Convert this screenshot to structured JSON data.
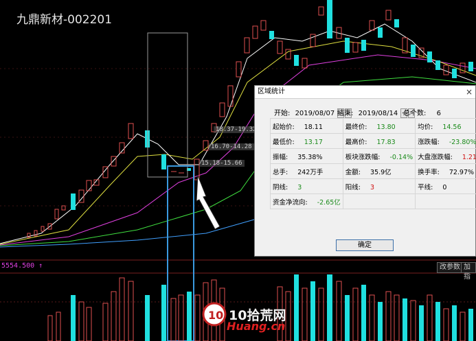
{
  "stock_title": "九鼎新材-002201",
  "volume_label": "5554.500 ↑",
  "buttons": {
    "vol_params": "改参数",
    "add": "加指"
  },
  "annotations": [
    "18.37-19.32",
    "16.70-14.28",
    "15.18-15.66"
  ],
  "watermark": {
    "main": "10拾荒网",
    "sub": "Huang.cn"
  },
  "dialog": {
    "title": "区域统计",
    "close": "×",
    "start_label": "开始:",
    "start_value": "2019/08/07",
    "end_label": "结束:",
    "end_value": "2019/08/14",
    "count_label": "总个数:",
    "count_value": "6",
    "rows": [
      [
        {
          "label": "起始价:",
          "value": "18.11",
          "color": "black"
        },
        {
          "label": "最终价:",
          "value": "13.80",
          "color": "green"
        },
        {
          "label": "均价:",
          "value": "14.56",
          "color": "green"
        }
      ],
      [
        {
          "label": "最低价:",
          "value": "13.17",
          "color": "green"
        },
        {
          "label": "最高价:",
          "value": "17.83",
          "color": "green"
        },
        {
          "label": "涨跌幅:",
          "value": "-23.80%",
          "color": "green"
        }
      ],
      [
        {
          "label": "振幅:",
          "value": "35.38%",
          "color": "black"
        },
        {
          "label": "板块涨跌幅:",
          "value": "-0.14%",
          "color": "green"
        },
        {
          "label": "大盘涨跌幅:",
          "value": "1.21%",
          "color": "red"
        }
      ],
      [
        {
          "label": "总手:",
          "value": "242万手",
          "color": "black"
        },
        {
          "label": "金额:",
          "value": "35.9亿",
          "color": "black"
        },
        {
          "label": "换手率:",
          "value": "72.97%",
          "color": "black"
        }
      ],
      [
        {
          "label": "阴线:",
          "value": "3",
          "color": "green"
        },
        {
          "label": "阳线:",
          "value": "3",
          "color": "red"
        },
        {
          "label": "平线:",
          "value": "0",
          "color": "black"
        }
      ],
      [
        {
          "label": "资金净流向:",
          "value": "-2.65亿",
          "color": "green"
        },
        {
          "label": "",
          "value": "",
          "color": "black"
        },
        {
          "label": "",
          "value": "",
          "color": "black"
        }
      ]
    ],
    "ok": "确定"
  },
  "colors": {
    "up": "#e05050",
    "down": "#20e0e0",
    "ma5": "#ffffff",
    "ma10": "#e0e040",
    "ma20": "#e040e0",
    "ma30": "#40e040",
    "ma60": "#40a0ff"
  }
}
